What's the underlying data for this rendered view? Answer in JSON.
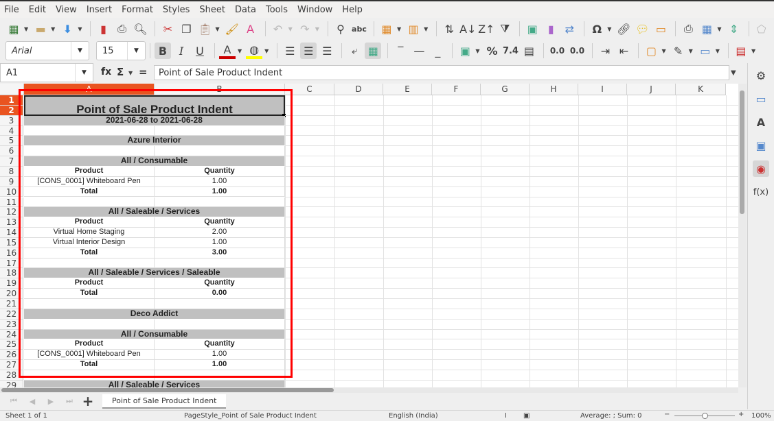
{
  "menu": [
    "File",
    "Edit",
    "View",
    "Insert",
    "Format",
    "Styles",
    "Sheet",
    "Data",
    "Tools",
    "Window",
    "Help"
  ],
  "toolbar": {
    "font_name": "Arial",
    "font_size": "15",
    "number_format_label": "%",
    "decimal_label": "7.4",
    "add_decimal": "0.0",
    "remove_decimal": "0.0"
  },
  "formula_bar": {
    "cell_ref": "A1",
    "fx": "fx",
    "sigma": "Σ",
    "equals": "=",
    "content": "Point of Sale Product Indent"
  },
  "columns": [
    "A",
    "B",
    "C",
    "D",
    "E",
    "F",
    "G",
    "H",
    "I",
    "J",
    "K"
  ],
  "selected_cell": "A1",
  "rows": [
    {
      "n": 1,
      "type": "title",
      "a": "Point of Sale Product Indent"
    },
    {
      "n": 2,
      "type": "title-cont"
    },
    {
      "n": 3,
      "type": "banner",
      "a": "2021-06-28 to 2021-06-28"
    },
    {
      "n": 4,
      "type": "empty"
    },
    {
      "n": 5,
      "type": "banner",
      "a": "Azure Interior"
    },
    {
      "n": 6,
      "type": "empty"
    },
    {
      "n": 7,
      "type": "banner",
      "a": "All / Consumable"
    },
    {
      "n": 8,
      "type": "bold",
      "a": "Product",
      "b": "Quantity"
    },
    {
      "n": 9,
      "type": "normal",
      "a": "[CONS_0001] Whiteboard Pen",
      "b": "1.00"
    },
    {
      "n": 10,
      "type": "bold",
      "a": "Total",
      "b": "1.00"
    },
    {
      "n": 11,
      "type": "empty"
    },
    {
      "n": 12,
      "type": "banner",
      "a": "All / Saleable / Services"
    },
    {
      "n": 13,
      "type": "bold",
      "a": "Product",
      "b": "Quantity"
    },
    {
      "n": 14,
      "type": "normal",
      "a": "Virtual Home Staging",
      "b": "2.00"
    },
    {
      "n": 15,
      "type": "normal",
      "a": "Virtual Interior Design",
      "b": "1.00"
    },
    {
      "n": 16,
      "type": "bold",
      "a": "Total",
      "b": "3.00"
    },
    {
      "n": 17,
      "type": "empty"
    },
    {
      "n": 18,
      "type": "banner",
      "a": "All / Saleable / Services / Saleable"
    },
    {
      "n": 19,
      "type": "bold",
      "a": "Product",
      "b": "Quantity"
    },
    {
      "n": 20,
      "type": "bold",
      "a": "Total",
      "b": "0.00"
    },
    {
      "n": 21,
      "type": "empty"
    },
    {
      "n": 22,
      "type": "banner",
      "a": "Deco Addict"
    },
    {
      "n": 23,
      "type": "empty"
    },
    {
      "n": 24,
      "type": "banner",
      "a": "All / Consumable"
    },
    {
      "n": 25,
      "type": "bold",
      "a": "Product",
      "b": "Quantity"
    },
    {
      "n": 26,
      "type": "normal",
      "a": "[CONS_0001] Whiteboard Pen",
      "b": "1.00"
    },
    {
      "n": 27,
      "type": "bold",
      "a": "Total",
      "b": "1.00"
    },
    {
      "n": 28,
      "type": "empty"
    },
    {
      "n": 29,
      "type": "banner",
      "a": "All / Saleable / Services"
    }
  ],
  "sheet_tab": "Point of Sale Product Indent",
  "status": {
    "sheet": "Sheet 1 of 1",
    "page_style": "PageStyle_Point of Sale Product Indent",
    "language": "English (India)",
    "summary": "Average: ; Sum: 0",
    "zoom": "100%"
  },
  "colors": {
    "accent": "#e95420",
    "banner": "#c0c0c0",
    "annotation": "#ff0000"
  }
}
